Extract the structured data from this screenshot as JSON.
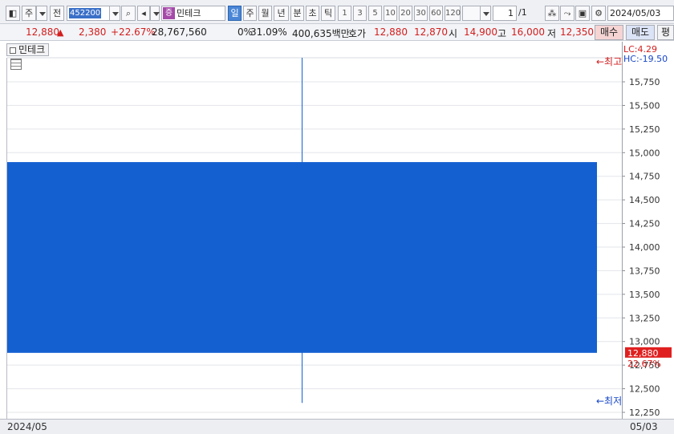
{
  "toolbar": {
    "market_label": "주",
    "view_label": "전",
    "stock_code": "452200",
    "stock_badge": "증",
    "stock_name": "민테크",
    "periods": [
      {
        "label": "일",
        "selected": true
      },
      {
        "label": "주",
        "selected": false
      },
      {
        "label": "월",
        "selected": false
      },
      {
        "label": "년",
        "selected": false
      },
      {
        "label": "분",
        "selected": false
      },
      {
        "label": "초",
        "selected": false
      },
      {
        "label": "틱",
        "selected": false
      }
    ],
    "intervals": [
      "1",
      "3",
      "5",
      "10",
      "20",
      "30",
      "60",
      "120"
    ],
    "page_current": "1",
    "page_total": "/1",
    "date": "2024/05/03"
  },
  "quote": {
    "price": "12,880",
    "change": "2,380",
    "change_pct": "+22.67%",
    "volume": "28,767,560",
    "vol_ratio": "0%",
    "turnover_pct": "31.09%",
    "amount": "400,635백만",
    "hoga_label": "호가",
    "ask": "12,880",
    "bid": "12,870",
    "open_label": "시",
    "open": "14,900",
    "high_label": "고",
    "high": "16,000",
    "low_label": "저",
    "low": "12,350",
    "buy_label": "매수",
    "sell_label": "매도",
    "extra_label": "평"
  },
  "chart": {
    "label": "민테크",
    "lc": "LC:4.29",
    "hc": "HC:-19.50",
    "max_marker": "←최고",
    "min_marker": "←최저",
    "current_price_tag": "12,880",
    "current_pct": "22.67%",
    "x_start": "2024/05",
    "x_end": "05/03",
    "colors": {
      "down_candle": "#1460d1",
      "up": "#d21e1e",
      "down": "#1646c8",
      "price_tag_bg": "#e02020"
    }
  },
  "chart_data": {
    "type": "candlestick",
    "x": [
      "2024/05/03"
    ],
    "open": [
      14900
    ],
    "high": [
      16000
    ],
    "low": [
      12350
    ],
    "close": [
      12880
    ],
    "y_ticks": [
      12250,
      12500,
      12750,
      13000,
      13250,
      13500,
      13750,
      14000,
      14250,
      14500,
      14750,
      15000,
      15250,
      15500,
      15750
    ],
    "y_tick_labels": [
      "12,250",
      "12,500",
      "12,750",
      "13,000",
      "13,250",
      "13,500",
      "13,750",
      "14,000",
      "14,250",
      "14,500",
      "14,750",
      "15,000",
      "15,250",
      "15,500",
      "15,750"
    ],
    "ylim": [
      12250,
      16000
    ]
  }
}
